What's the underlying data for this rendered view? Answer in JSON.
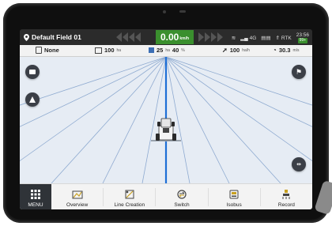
{
  "status_bar": {
    "field_name": "Default Field 01",
    "speed": "0.00",
    "speed_unit": "km/h",
    "signal": "4G",
    "rtk": "RTK",
    "time": "23:56",
    "badge": "99+"
  },
  "info_bar": {
    "implement": "None",
    "width": "100",
    "width_unit": "ha",
    "area": "25",
    "area_unit": "ha",
    "progress": "40",
    "progress_unit": "%",
    "rate": "100",
    "rate_unit": "ha/h",
    "distance": "30.3",
    "distance_unit": "m/s"
  },
  "map": {
    "guide_line_color": "#1e6fd6",
    "grid_line_color": "#8eaad0",
    "background": "#e6ecf4"
  },
  "nav": {
    "menu_label": "MENU",
    "items": [
      {
        "label": "Overview",
        "icon": "overview-icon"
      },
      {
        "label": "Line Creation",
        "icon": "line-creation-icon"
      },
      {
        "label": "Switch",
        "icon": "switch-icon"
      },
      {
        "label": "Isobus",
        "icon": "isobus-icon"
      },
      {
        "label": "Record",
        "icon": "record-icon"
      }
    ]
  },
  "colors": {
    "accent": "#3a8f2e",
    "status_bar": "#2b2b2b",
    "menu_bg": "#2f3338"
  }
}
